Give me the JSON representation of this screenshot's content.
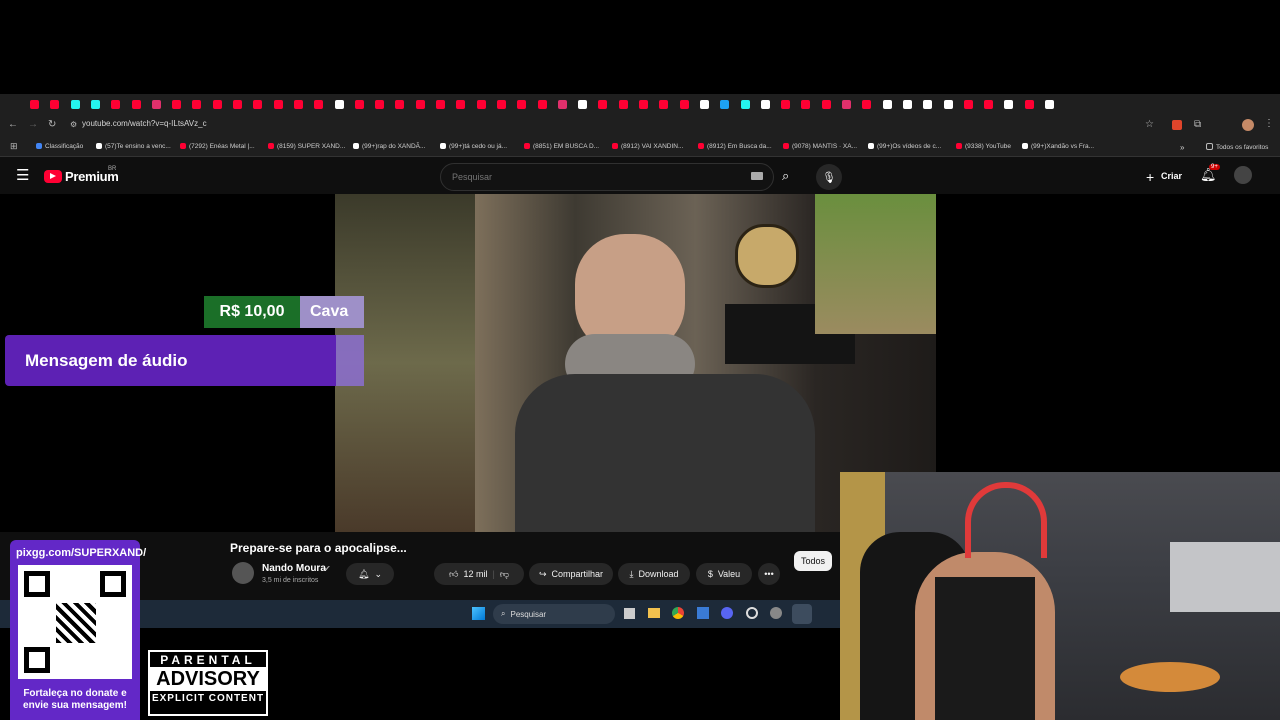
{
  "browser": {
    "url": "youtube.com/watch?v=q-ILtsAVz_c",
    "tab_colors": [
      "#ff0033",
      "#e1306c",
      "#1da1f2",
      "#25f4ee",
      "#ffffff"
    ],
    "bookmarks": [
      {
        "label": "Classificação",
        "color": "#4285f4"
      },
      {
        "label": "(57)Te ensino a venc...",
        "color": "#ffffff"
      },
      {
        "label": "(7292) Enéas Metal |...",
        "color": "#ff0033"
      },
      {
        "label": "(8159) SUPER XAND...",
        "color": "#ff0033"
      },
      {
        "label": "(99+)rap do XANDÃ...",
        "color": "#ffffff"
      },
      {
        "label": "(99+)tá cedo ou já...",
        "color": "#ffffff"
      },
      {
        "label": "(8851) EM BUSCA D...",
        "color": "#ff0033"
      },
      {
        "label": "(8912) VAI XANDIN...",
        "color": "#ff0033"
      },
      {
        "label": "(8912) Em Busca da...",
        "color": "#ff0033"
      },
      {
        "label": "(9078) MANTIS · XA...",
        "color": "#ff0033"
      },
      {
        "label": "(99+)Os vídeos de c...",
        "color": "#ffffff"
      },
      {
        "label": "(9338) YouTube",
        "color": "#ff0033"
      },
      {
        "label": "(99+)Xandão vs Fra...",
        "color": "#ffffff"
      }
    ],
    "all_bookmarks": "Todos os favoritos"
  },
  "youtube": {
    "logo": "Premium",
    "region": "BR",
    "search_placeholder": "Pesquisar",
    "create_label": "Criar",
    "notif_badge": "9+",
    "video_title": "Prepare-se para o apocalipse...",
    "channel_name": "Nando Moura",
    "subscribers": "3,5 mi de inscritos",
    "likes": "12 mil",
    "share_label": "Compartilhar",
    "download_label": "Download",
    "thanks_label": "Valeu",
    "filter_all": "Todos"
  },
  "overlay": {
    "donation_amount": "R$ 10,00",
    "donation_name": "Cava",
    "audio_message": "Mensagem de áudio",
    "pix_url": "pixgg.com/SUPERXAND/",
    "pix_caption": "Fortaleça no donate e envie sua mensagem!",
    "advisory_top": "PARENTAL",
    "advisory_mid": "ADVISORY",
    "advisory_bottom": "EXPLICIT CONTENT"
  },
  "taskbar": {
    "search_label": "Pesquisar"
  }
}
